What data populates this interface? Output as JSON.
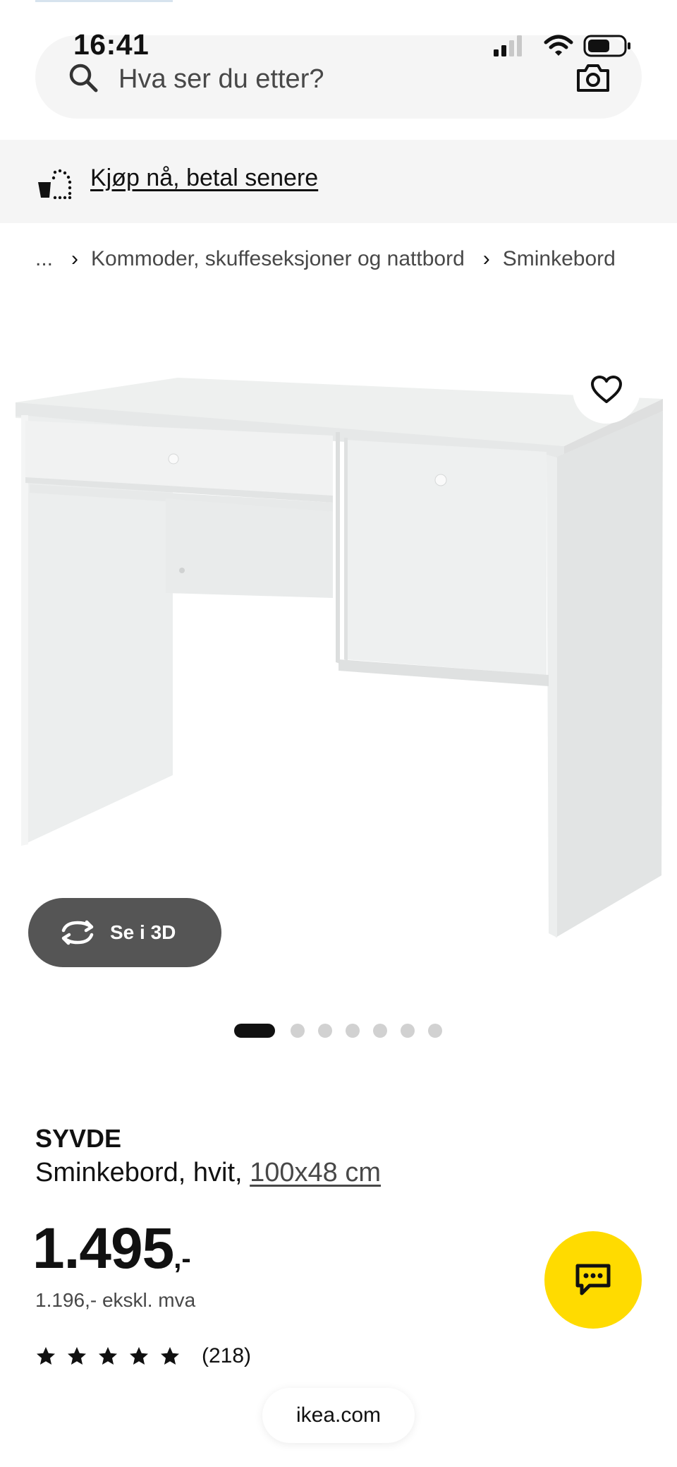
{
  "status_bar": {
    "time": "16:41"
  },
  "search": {
    "placeholder": "Hva ser du etter?"
  },
  "promo": {
    "label": "Kjøp nå, betal senere"
  },
  "breadcrumb": {
    "items": [
      "...",
      "Kommoder, skuffeseksjoner og nattbord",
      "Sminkebord"
    ],
    "separator": "›"
  },
  "gallery": {
    "view_3d_label": "Se i 3D",
    "dot_count": 7,
    "active_index": 0
  },
  "product": {
    "name": "SYVDE",
    "description": "Sminkebord, hvit, ",
    "measure": "100x48 cm",
    "price_integer": "1.495",
    "price_suffix": ",-",
    "price_ex_vat": "1.196,- ekskl. mva",
    "rating_stars": 5,
    "rating_count": "(218)"
  },
  "browser": {
    "url": "ikea.com"
  },
  "colors": {
    "chat_button": "#ffdb00",
    "view3d_button": "#555555",
    "band_gray": "#f5f5f5"
  },
  "icons": {
    "search": "search-icon",
    "camera": "camera-icon",
    "promo": "payment-bag-icon",
    "favorite": "heart-icon",
    "view3d": "rotate-3d-icon",
    "chat": "chat-icon",
    "star": "star-icon"
  }
}
